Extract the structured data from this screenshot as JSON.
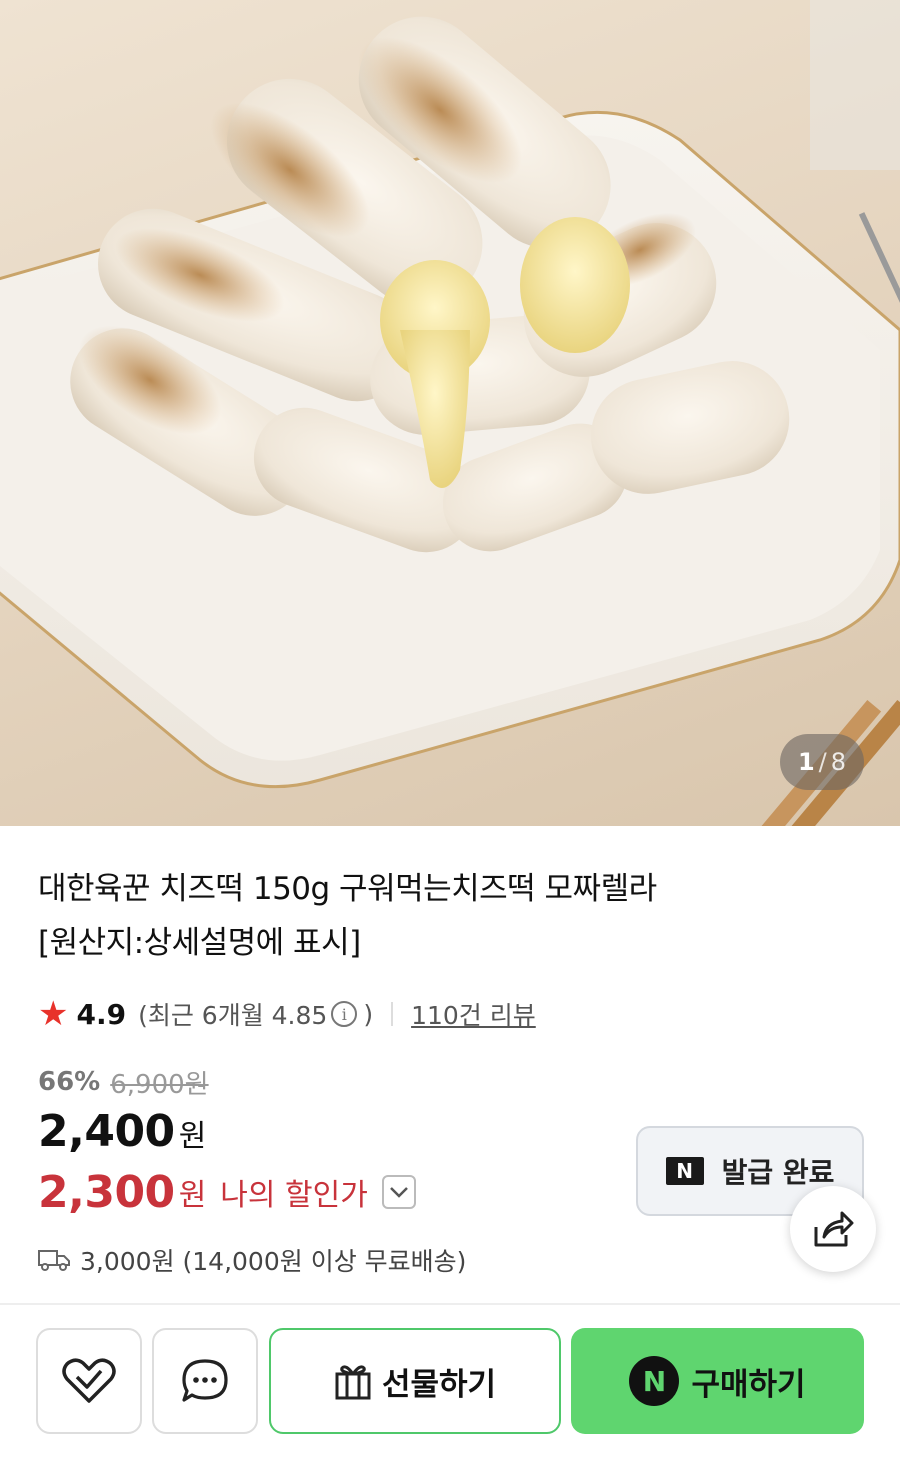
{
  "gallery": {
    "current": "1",
    "separator": "/",
    "total": "8"
  },
  "product": {
    "title_line1": "대한육꾼 치즈떡 150g 구워먹는치즈떡 모짜렐라",
    "title_line2": "[원산지:상세설명에 표시]"
  },
  "rating": {
    "star_icon": "star-icon",
    "score": "4.9",
    "recent_label": "(최근 6개월 4.85",
    "recent_close": ")",
    "info_glyph": "i",
    "reviews": "110건 리뷰"
  },
  "pricing": {
    "discount_rate": "66%",
    "original_price": "6,900원",
    "price": "2,400",
    "price_unit": "원",
    "my_price": "2,300",
    "my_price_unit": "원",
    "my_price_label": "나의 할인가"
  },
  "coupon": {
    "logo": "N",
    "label": "발급 완료"
  },
  "shipping": {
    "text": "3,000원 (14,000원 이상 무료배송)"
  },
  "bottom_bar": {
    "gift_label": "선물하기",
    "buy_logo": "N",
    "buy_label": "구매하기"
  },
  "colors": {
    "accent_red": "#c8333b",
    "star_red": "#e8322b",
    "naver_green": "#5fd56f",
    "gift_border": "#4fc86a"
  }
}
